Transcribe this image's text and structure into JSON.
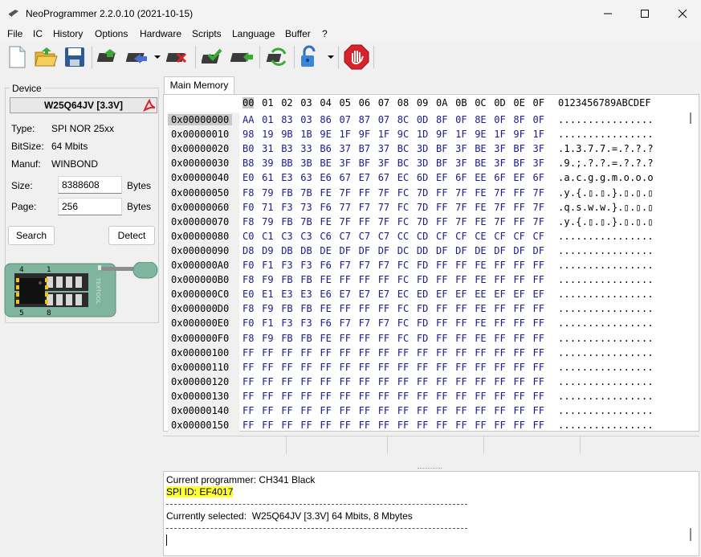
{
  "window": {
    "title": "NeoProgrammer 2.2.0.10 (2021-10-15)"
  },
  "menu": [
    "File",
    "IC",
    "History",
    "Options",
    "Hardware",
    "Scripts",
    "Language",
    "Buffer",
    "?"
  ],
  "device": {
    "legend": "Device",
    "name": "W25Q64JV [3.3V]",
    "type_label": "Type:",
    "type_value": "SPI NOR 25xx",
    "bitsize_label": "BitSize:",
    "bitsize_value": "64 Mbits",
    "manuf_label": "Manuf:",
    "manuf_value": "WINBOND",
    "size_label": "Size:",
    "size_value": "8388608",
    "size_unit": "Bytes",
    "page_label": "Page:",
    "page_value": "256",
    "page_unit": "Bytes",
    "search_button": "Search",
    "detect_button": "Detect",
    "chip": {
      "pin_top_left": "4",
      "pin_top_right": "1",
      "pin_bottom_left": "5",
      "pin_bottom_right": "8",
      "brand": "TEXTOOL"
    }
  },
  "tabs": [
    "Main Memory"
  ],
  "hex": {
    "header_columns": [
      "00",
      "01",
      "02",
      "03",
      "04",
      "05",
      "06",
      "07",
      "08",
      "09",
      "0A",
      "0B",
      "0C",
      "0D",
      "0E",
      "0F"
    ],
    "ascii_header": "0123456789ABCDEF",
    "rows": [
      {
        "addr": "0x00000000",
        "bytes": [
          "AA",
          "01",
          "83",
          "03",
          "86",
          "07",
          "87",
          "07",
          "8C",
          "0D",
          "8F",
          "0F",
          "8E",
          "0F",
          "8F",
          "0F"
        ],
        "ascii": "................"
      },
      {
        "addr": "0x00000010",
        "bytes": [
          "98",
          "19",
          "9B",
          "1B",
          "9E",
          "1F",
          "9F",
          "1F",
          "9C",
          "1D",
          "9F",
          "1F",
          "9E",
          "1F",
          "9F",
          "1F"
        ],
        "ascii": "................"
      },
      {
        "addr": "0x00000020",
        "bytes": [
          "B0",
          "31",
          "B3",
          "33",
          "B6",
          "37",
          "B7",
          "37",
          "BC",
          "3D",
          "BF",
          "3F",
          "BE",
          "3F",
          "BF",
          "3F"
        ],
        "ascii": ".1.3.7.7.=.?.?.?"
      },
      {
        "addr": "0x00000030",
        "bytes": [
          "B8",
          "39",
          "BB",
          "3B",
          "BE",
          "3F",
          "BF",
          "3F",
          "BC",
          "3D",
          "BF",
          "3F",
          "BE",
          "3F",
          "BF",
          "3F"
        ],
        "ascii": ".9.;.?.?.=.?.?.?"
      },
      {
        "addr": "0x00000040",
        "bytes": [
          "E0",
          "61",
          "E3",
          "63",
          "E6",
          "67",
          "E7",
          "67",
          "EC",
          "6D",
          "EF",
          "6F",
          "EE",
          "6F",
          "EF",
          "6F"
        ],
        "ascii": ".a.c.g.g.m.o.o.o"
      },
      {
        "addr": "0x00000050",
        "bytes": [
          "F8",
          "79",
          "FB",
          "7B",
          "FE",
          "7F",
          "FF",
          "7F",
          "FC",
          "7D",
          "FF",
          "7F",
          "FE",
          "7F",
          "FF",
          "7F"
        ],
        "ascii": ".y.{.▯.▯.}.▯.▯.▯"
      },
      {
        "addr": "0x00000060",
        "bytes": [
          "F0",
          "71",
          "F3",
          "73",
          "F6",
          "77",
          "F7",
          "77",
          "FC",
          "7D",
          "FF",
          "7F",
          "FE",
          "7F",
          "FF",
          "7F"
        ],
        "ascii": ".q.s.w.w.}.▯.▯.▯"
      },
      {
        "addr": "0x00000070",
        "bytes": [
          "F8",
          "79",
          "FB",
          "7B",
          "FE",
          "7F",
          "FF",
          "7F",
          "FC",
          "7D",
          "FF",
          "7F",
          "FE",
          "7F",
          "FF",
          "7F"
        ],
        "ascii": ".y.{.▯.▯.}.▯.▯.▯"
      },
      {
        "addr": "0x00000080",
        "bytes": [
          "C0",
          "C1",
          "C3",
          "C3",
          "C6",
          "C7",
          "C7",
          "C7",
          "CC",
          "CD",
          "CF",
          "CF",
          "CE",
          "CF",
          "CF",
          "CF"
        ],
        "ascii": "................"
      },
      {
        "addr": "0x00000090",
        "bytes": [
          "D8",
          "D9",
          "DB",
          "DB",
          "DE",
          "DF",
          "DF",
          "DF",
          "DC",
          "DD",
          "DF",
          "DF",
          "DE",
          "DF",
          "DF",
          "DF"
        ],
        "ascii": "................"
      },
      {
        "addr": "0x000000A0",
        "bytes": [
          "F0",
          "F1",
          "F3",
          "F3",
          "F6",
          "F7",
          "F7",
          "F7",
          "FC",
          "FD",
          "FF",
          "FF",
          "FE",
          "FF",
          "FF",
          "FF"
        ],
        "ascii": "................"
      },
      {
        "addr": "0x000000B0",
        "bytes": [
          "F8",
          "F9",
          "FB",
          "FB",
          "FE",
          "FF",
          "FF",
          "FF",
          "FC",
          "FD",
          "FF",
          "FF",
          "FE",
          "FF",
          "FF",
          "FF"
        ],
        "ascii": "................"
      },
      {
        "addr": "0x000000C0",
        "bytes": [
          "E0",
          "E1",
          "E3",
          "E3",
          "E6",
          "E7",
          "E7",
          "E7",
          "EC",
          "ED",
          "EF",
          "EF",
          "EE",
          "EF",
          "EF",
          "EF"
        ],
        "ascii": "................"
      },
      {
        "addr": "0x000000D0",
        "bytes": [
          "F8",
          "F9",
          "FB",
          "FB",
          "FE",
          "FF",
          "FF",
          "FF",
          "FC",
          "FD",
          "FF",
          "FF",
          "FE",
          "FF",
          "FF",
          "FF"
        ],
        "ascii": "................"
      },
      {
        "addr": "0x000000E0",
        "bytes": [
          "F0",
          "F1",
          "F3",
          "F3",
          "F6",
          "F7",
          "F7",
          "F7",
          "FC",
          "FD",
          "FF",
          "FF",
          "FE",
          "FF",
          "FF",
          "FF"
        ],
        "ascii": "................"
      },
      {
        "addr": "0x000000F0",
        "bytes": [
          "F8",
          "F9",
          "FB",
          "FB",
          "FE",
          "FF",
          "FF",
          "FF",
          "FC",
          "FD",
          "FF",
          "FF",
          "FE",
          "FF",
          "FF",
          "FF"
        ],
        "ascii": "................"
      },
      {
        "addr": "0x00000100",
        "bytes": [
          "FF",
          "FF",
          "FF",
          "FF",
          "FF",
          "FF",
          "FF",
          "FF",
          "FF",
          "FF",
          "FF",
          "FF",
          "FF",
          "FF",
          "FF",
          "FF"
        ],
        "ascii": "................"
      },
      {
        "addr": "0x00000110",
        "bytes": [
          "FF",
          "FF",
          "FF",
          "FF",
          "FF",
          "FF",
          "FF",
          "FF",
          "FF",
          "FF",
          "FF",
          "FF",
          "FF",
          "FF",
          "FF",
          "FF"
        ],
        "ascii": "................"
      },
      {
        "addr": "0x00000120",
        "bytes": [
          "FF",
          "FF",
          "FF",
          "FF",
          "FF",
          "FF",
          "FF",
          "FF",
          "FF",
          "FF",
          "FF",
          "FF",
          "FF",
          "FF",
          "FF",
          "FF"
        ],
        "ascii": "................"
      },
      {
        "addr": "0x00000130",
        "bytes": [
          "FF",
          "FF",
          "FF",
          "FF",
          "FF",
          "FF",
          "FF",
          "FF",
          "FF",
          "FF",
          "FF",
          "FF",
          "FF",
          "FF",
          "FF",
          "FF"
        ],
        "ascii": "................"
      },
      {
        "addr": "0x00000140",
        "bytes": [
          "FF",
          "FF",
          "FF",
          "FF",
          "FF",
          "FF",
          "FF",
          "FF",
          "FF",
          "FF",
          "FF",
          "FF",
          "FF",
          "FF",
          "FF",
          "FF"
        ],
        "ascii": "................"
      },
      {
        "addr": "0x00000150",
        "bytes": [
          "FF",
          "FF",
          "FF",
          "FF",
          "FF",
          "FF",
          "FF",
          "FF",
          "FF",
          "FF",
          "FF",
          "FF",
          "FF",
          "FF",
          "FF",
          "FF"
        ],
        "ascii": "................"
      }
    ]
  },
  "log": {
    "line1": "Current programmer: CH341 Black",
    "line2": "SPI ID: EF4017",
    "line3": "Currently selected:  W25Q64JV [3.3V] 64 Mbits, 8 Mbytes"
  },
  "colors": {
    "hex_byte": "#1a1a8c",
    "highlight": "#ffff33",
    "chip_board": "#7fb59f"
  }
}
